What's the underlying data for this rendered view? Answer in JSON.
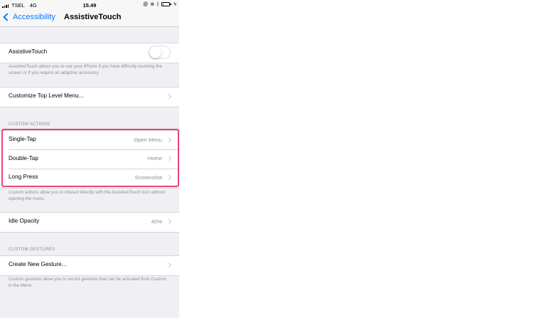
{
  "status_bar": {
    "carrier": "TSEL",
    "network": "4G",
    "time": "15.49",
    "battery_level": 0.15,
    "icons": [
      "signal-icon",
      "alarm-icon",
      "lock-rotation-icon",
      "bluetooth-icon",
      "battery-icon",
      "charging-icon"
    ]
  },
  "nav": {
    "back_label": "Accessibility",
    "title": "AssistiveTouch"
  },
  "assistive_touch": {
    "label": "AssistiveTouch",
    "enabled": false,
    "footer": "AssistiveTouch allows you to use your iPhone if you have difficulty touching the screen or if you require an adaptive accessory."
  },
  "customize": {
    "label": "Customize Top Level Menu..."
  },
  "custom_actions": {
    "header": "CUSTOM ACTIONS",
    "rows": [
      {
        "label": "Single-Tap",
        "value": "Open Menu"
      },
      {
        "label": "Double-Tap",
        "value": "Home"
      },
      {
        "label": "Long Press",
        "value": "Screenshot"
      }
    ],
    "footer": "Custom actions allow you to interact directly with the AssistiveTouch icon without opening the menu."
  },
  "idle_opacity": {
    "label": "Idle Opacity",
    "value": "40%"
  },
  "custom_gestures": {
    "header": "CUSTOM GESTURES",
    "create_label": "Create New Gesture...",
    "footer": "Custom gestures allow you to record gestures that can be activated from Custom in the Menu."
  },
  "colors": {
    "accent": "#007aff",
    "highlight": "#e8437b",
    "background": "#efeff4"
  }
}
